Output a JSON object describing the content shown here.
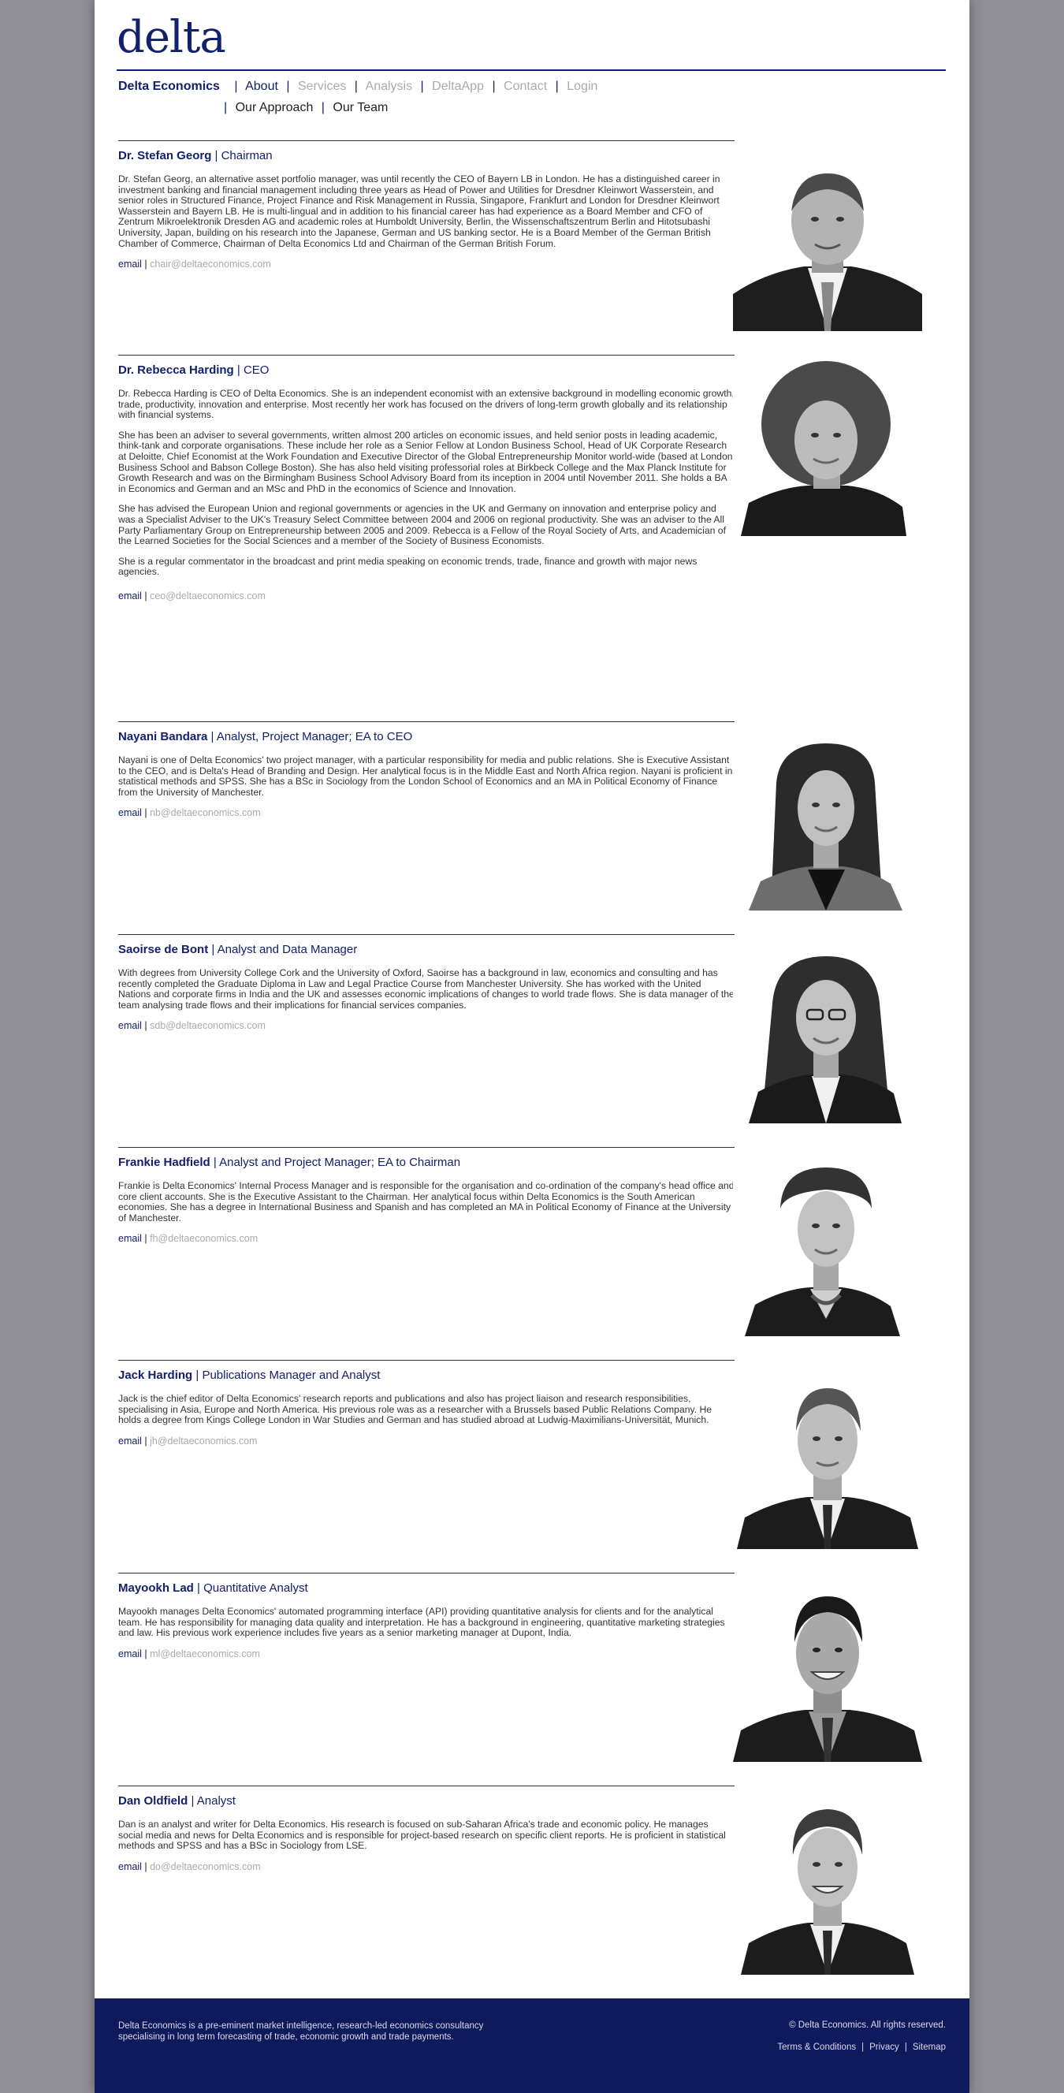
{
  "logo": {
    "text": "delta"
  },
  "nav": {
    "brand": "Delta Economics",
    "items": [
      {
        "label": "About",
        "active": true
      },
      {
        "label": "Services",
        "active": false
      },
      {
        "label": "Analysis",
        "active": false
      },
      {
        "label": "DeltaApp",
        "active": false
      },
      {
        "label": "Contact",
        "active": false
      },
      {
        "label": "Login",
        "active": false
      }
    ],
    "sub_items": [
      {
        "label": "Our Approach",
        "active": false
      },
      {
        "label": "Our Team",
        "active": true
      }
    ],
    "separator": "|"
  },
  "team": [
    {
      "name": "Dr. Stefan Georg",
      "role": "Chairman",
      "bio": [
        "Dr. Stefan Georg, an alternative asset portfolio manager, was until recently the CEO of Bayern LB in London. He has a distinguished career in investment banking and financial management including three years as Head of Power and Utilities for Dresdner Kleinwort Wasserstein, and senior roles in Structured Finance, Project Finance and Risk Management in Russia, Singapore, Frankfurt and London for Dresdner Kleinwort Wasserstein and Bayern LB. He is multi-lingual and in addition to his financial career has had experience as a Board Member and CFO of Zentrum Mikroelektronik Dresden AG and academic roles at Humboldt University, Berlin, the Wissenschaftszentrum Berlin and Hitotsubashi University, Japan, building on his research into the Japanese, German and US banking sector. He is a Board Member of the German British Chamber of Commerce, Chairman of Delta Economics Ltd and Chairman of the German British Forum."
      ],
      "email_label": "email",
      "email": "chair@deltaeconomics.com"
    },
    {
      "name": "Dr. Rebecca Harding",
      "role": "CEO",
      "bio": [
        "Dr. Rebecca Harding is CEO of Delta Economics. She is an independent economist with an extensive background in modelling economic growth, trade, productivity, innovation and enterprise. Most recently her work has focused on the drivers of long-term growth globally and its relationship with financial systems.",
        "She has been an adviser to several governments, written almost 200 articles on economic issues, and held senior posts in leading academic, think-tank and corporate organisations. These include her role as a Senior Fellow at London Business School, Head of UK Corporate Research at Deloitte, Chief Economist at the Work Foundation and Executive Director of the Global Entrepreneurship Monitor world-wide (based at London Business School and Babson College Boston). She has also held visiting professorial roles at Birkbeck College and the Max Planck Institute for Growth Research and was on the Birmingham Business School Advisory Board from its inception in 2004 until November 2011. She holds a BA in Economics and German and an MSc and PhD in the economics of Science and Innovation.",
        "She has advised the European Union and regional governments or agencies in the UK and Germany on innovation and enterprise policy and was a Specialist Adviser to the UK's Treasury Select Committee between 2004 and 2006 on regional productivity. She was an adviser to the All Party Parliamentary Group on Entrepreneurship between 2005 and 2009.  Rebecca is a Fellow of the Royal Society of Arts, and Academician of the Learned Societies for the Social Sciences and a member of the Society of Business Economists.",
        "She is a regular commentator in the broadcast and print media speaking on economic trends, trade, finance and growth with major news agencies."
      ],
      "email_label": "email",
      "email": "ceo@deltaeconomics.com"
    },
    {
      "name": "Nayani Bandara",
      "role": "Analyst, Project Manager; EA to CEO",
      "bio": [
        "Nayani is one of Delta Economics' two project manager, with a particular responsibility for media and public relations. She is Executive Assistant to the CEO, and is Delta's Head of Branding and Design. Her analytical focus is in the Middle East and North Africa region. Nayani is proficient in statistical methods and SPSS. She has a BSc in Sociology from the London School of Economics and an MA in Political Economy of Finance from the University of Manchester."
      ],
      "email_label": "email",
      "email": "nb@deltaeconomics.com"
    },
    {
      "name": "Saoirse de Bont",
      "role": "Analyst and Data Manager",
      "bio": [
        "With degrees from University College Cork and the University of Oxford, Saoirse has a background in law, economics and consulting and has recently completed the Graduate Diploma in Law and Legal Practice Course from Manchester University. She has worked with the United Nations and corporate firms in India and the UK and assesses economic implications of changes to world trade flows. She is data manager of the team analysing trade flows and their implications for financial services companies."
      ],
      "email_label": "email",
      "email": "sdb@deltaeconomics.com"
    },
    {
      "name": "Frankie Hadfield",
      "role": "Analyst and Project Manager; EA to Chairman",
      "bio": [
        "Frankie is Delta Economics' Internal Process Manager and is responsible for the organisation and co-ordination of the company's head office and core client accounts. She is the Executive Assistant to the Chairman.  Her analytical focus within Delta Economics is the South American economies.  She has a degree in International Business and Spanish and has completed an MA in Political Economy of Finance at the University of Manchester."
      ],
      "email_label": "email",
      "email": "fh@deltaeconomics.com"
    },
    {
      "name": "Jack Harding",
      "role": "Publications Manager and Analyst",
      "bio": [
        "Jack is the chief editor of Delta Economics' research reports and publications and also has project liaison and research responsibilities, specialising in Asia, Europe and North America. His previous role was as a researcher with a Brussels based Public Relations Company. He holds a degree from Kings College London in War Studies and German and has studied abroad at Ludwig-Maximilians-Universität, Munich."
      ],
      "email_label": "email",
      "email": "jh@deltaeconomics.com"
    },
    {
      "name": "Mayookh Lad",
      "role": "Quantitative Analyst",
      "bio": [
        "Mayookh manages Delta Economics' automated programming interface (API) providing quantitative analysis for clients and for the analytical team.  He has responsibility for managing data quality and interpretation. He has a background in engineering, quantitative marketing strategies and law.  His previous work experience includes five years as a senior marketing manager at Dupont, India."
      ],
      "email_label": "email",
      "email": "ml@deltaeconomics.com"
    },
    {
      "name": "Dan Oldfield",
      "role": "Analyst",
      "bio": [
        "Dan is an analyst and writer for Delta Economics. His research is focused on sub-Saharan Africa's trade and economic policy. He manages social media and news for Delta Economics and is responsible for project-based research on specific client reports.  He is proficient in statistical methods and SPSS and has a BSc in Sociology from LSE."
      ],
      "email_label": "email",
      "email": "do@deltaeconomics.com"
    }
  ],
  "footer": {
    "tagline": "Delta Economics is a pre-eminent market intelligence, research-led economics consultancy specialising in long term forecasting of trade, economic growth and trade payments.",
    "copyright": "© Delta Economics. All rights reserved.",
    "links": [
      "Terms & Conditions",
      "Privacy",
      "Sitemap"
    ]
  },
  "colors": {
    "brand": "#13206b",
    "footer_bg": "#0f1a5c",
    "muted": "#aaaaaa",
    "side_bg": "#8e8e94"
  }
}
